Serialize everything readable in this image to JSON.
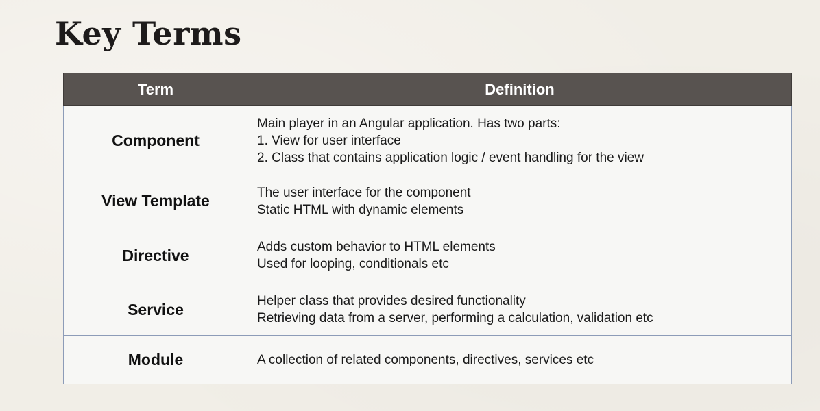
{
  "slide": {
    "title": "Key Terms"
  },
  "table": {
    "headers": {
      "term": "Term",
      "definition": "Definition"
    },
    "rows": [
      {
        "term": "Component",
        "lines": [
          "Main player in an Angular application. Has two parts:",
          "1. View for user interface",
          "2. Class that contains application logic / event handling for the view"
        ]
      },
      {
        "term": "View Template",
        "lines": [
          "The user interface for the component",
          "Static HTML with dynamic elements"
        ]
      },
      {
        "term": "Directive",
        "lines": [
          "Adds custom behavior to HTML elements",
          "Used for looping, conditionals etc"
        ]
      },
      {
        "term": "Service",
        "lines": [
          "Helper class that provides desired functionality",
          "Retrieving data from a server, performing a calculation, validation etc"
        ]
      },
      {
        "term": "Module",
        "lines": [
          "A collection of related components, directives, services etc"
        ]
      }
    ]
  },
  "colors": {
    "header_background": "#585350",
    "header_text": "#ffffff",
    "grid_lines": "#8d9cb8",
    "slide_background": "#f1eee7"
  }
}
